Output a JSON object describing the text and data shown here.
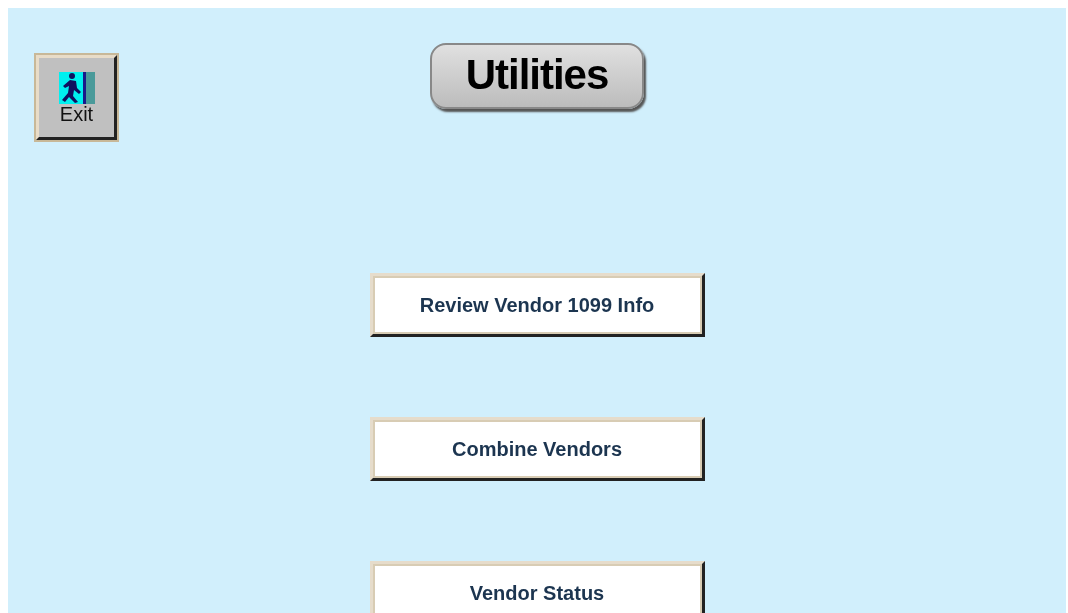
{
  "exit_button": {
    "label": "Exit"
  },
  "title": "Utilities",
  "buttons": [
    {
      "label": "Review Vendor 1099 Info"
    },
    {
      "label": "Combine Vendors"
    },
    {
      "label": "Vendor Status"
    }
  ]
}
